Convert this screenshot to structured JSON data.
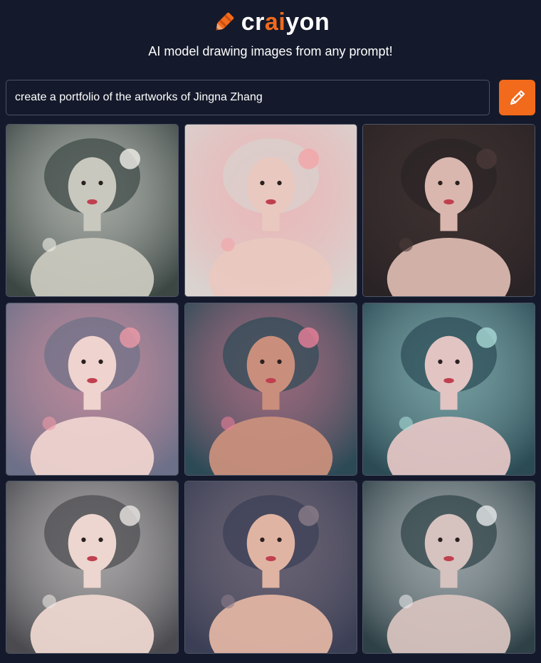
{
  "header": {
    "logo_prefix": "cr",
    "logo_highlight": "ai",
    "logo_suffix": "yon",
    "tagline": "AI model drawing images from any prompt!"
  },
  "prompt": {
    "value": "create a portfolio of the artworks of Jingna Zhang",
    "button_icon": "pencil-icon"
  },
  "colors": {
    "background": "#141a2b",
    "accent": "#f26a1b",
    "border": "#4a5266"
  },
  "results": [
    {
      "icon": "generated-image",
      "palette": [
        "#3c4744",
        "#c9c8be",
        "#f0efe8"
      ]
    },
    {
      "icon": "generated-image",
      "palette": [
        "#d9d3cf",
        "#e9c8c0",
        "#f4a4a8"
      ]
    },
    {
      "icon": "generated-image",
      "palette": [
        "#2a2325",
        "#d9b7ae",
        "#4a3a38"
      ]
    },
    {
      "icon": "generated-image",
      "palette": [
        "#6c7088",
        "#eed3cf",
        "#ee9aa6"
      ]
    },
    {
      "icon": "generated-image",
      "palette": [
        "#2c4a56",
        "#c98f7c",
        "#e87f98"
      ]
    },
    {
      "icon": "generated-image",
      "palette": [
        "#2b4a54",
        "#e2c4c3",
        "#a9d9d6"
      ]
    },
    {
      "icon": "generated-image",
      "palette": [
        "#4a4a4f",
        "#ecd6cf",
        "#e9e5e2"
      ]
    },
    {
      "icon": "generated-image",
      "palette": [
        "#3b3f55",
        "#e0b4a3",
        "#8a7c88"
      ]
    },
    {
      "icon": "generated-image",
      "palette": [
        "#2e4146",
        "#d6c2be",
        "#e6e8ea"
      ]
    }
  ]
}
